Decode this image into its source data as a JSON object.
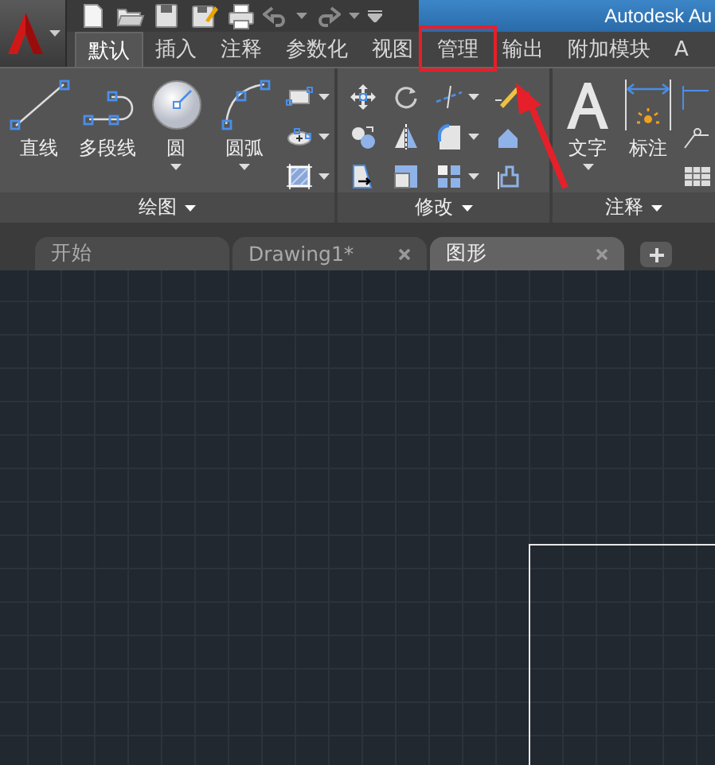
{
  "app": {
    "title": "Autodesk Au"
  },
  "ribbon_tabs": [
    {
      "label": "默认",
      "selected": true,
      "highlighted": false
    },
    {
      "label": "插入",
      "selected": false,
      "highlighted": false
    },
    {
      "label": "注释",
      "selected": false,
      "highlighted": false
    },
    {
      "label": "参数化",
      "selected": false,
      "highlighted": false
    },
    {
      "label": "视图",
      "selected": false,
      "highlighted": false
    },
    {
      "label": "管理",
      "selected": false,
      "highlighted": true
    },
    {
      "label": "输出",
      "selected": false,
      "highlighted": false
    },
    {
      "label": "附加模块",
      "selected": false,
      "highlighted": false
    },
    {
      "label": "A",
      "selected": false,
      "highlighted": false
    }
  ],
  "ribbon_panels": [
    {
      "title": "绘图",
      "large_buttons": [
        {
          "label": "直线",
          "dropdown": false
        },
        {
          "label": "多段线",
          "dropdown": false
        },
        {
          "label": "圆",
          "dropdown": true
        },
        {
          "label": "圆弧",
          "dropdown": true
        }
      ]
    },
    {
      "title": "修改"
    },
    {
      "title": "注释",
      "large_buttons": [
        {
          "label": "文字",
          "dropdown": true
        },
        {
          "label": "标注",
          "dropdown": false
        }
      ]
    }
  ],
  "document_tabs": [
    {
      "label": "开始",
      "selected": false,
      "closable": false
    },
    {
      "label": "Drawing1*",
      "selected": false,
      "closable": true
    },
    {
      "label": "图形",
      "selected": true,
      "closable": true
    }
  ]
}
